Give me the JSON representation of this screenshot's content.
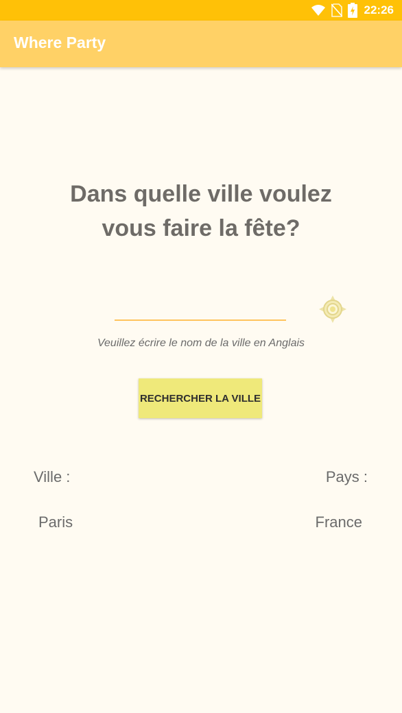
{
  "status_bar": {
    "time": "22:26",
    "icons": [
      "wifi-icon",
      "no-sim-icon",
      "battery-charging-icon"
    ],
    "color": "#FFC107"
  },
  "app_bar": {
    "title": "Where Party",
    "color": "#FFD166"
  },
  "main": {
    "heading_line1": "Dans quelle ville voulez",
    "heading_line2": "vous faire la fête?",
    "city_input_value": "",
    "locate_icon": "gps-target-icon",
    "hint": "Veuillez écrire le nom de la ville en Anglais",
    "search_button_label": "RECHERCHER LA VILLE",
    "search_button_color": "#EFE97A"
  },
  "results": {
    "city_label": "Ville :",
    "country_label": "Pays :",
    "city_value": "Paris",
    "country_value": "France"
  }
}
